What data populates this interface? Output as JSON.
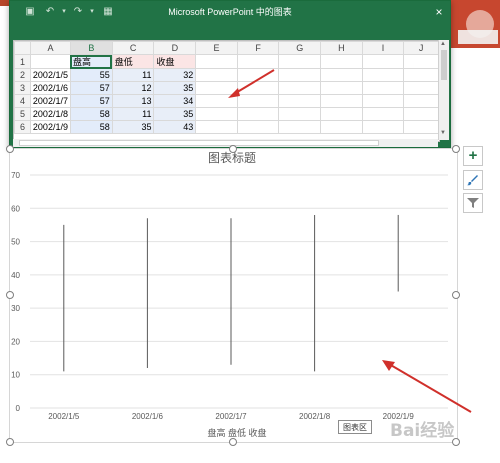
{
  "window": {
    "title": "Microsoft PowerPoint 中的图表",
    "close_icon": "×"
  },
  "sheet": {
    "columns": [
      "A",
      "B",
      "C",
      "D",
      "E",
      "F",
      "G",
      "H",
      "I",
      "J"
    ],
    "row_numbers": [
      "1",
      "2",
      "3",
      "4",
      "5",
      "6"
    ],
    "header_row": [
      "",
      "盘高",
      "盘低",
      "收盘"
    ],
    "rows": [
      [
        "2002/1/5",
        "55",
        "11",
        "32"
      ],
      [
        "2002/1/6",
        "57",
        "12",
        "35"
      ],
      [
        "2002/1/7",
        "57",
        "13",
        "34"
      ],
      [
        "2002/1/8",
        "58",
        "11",
        "35"
      ],
      [
        "2002/1/9",
        "58",
        "35",
        "43"
      ]
    ]
  },
  "chart_data": {
    "type": "stock",
    "title": "图表标题",
    "categories": [
      "2002/1/5",
      "2002/1/6",
      "2002/1/7",
      "2002/1/8",
      "2002/1/9"
    ],
    "series": [
      {
        "name": "盘高",
        "values": [
          55,
          57,
          57,
          58,
          58
        ]
      },
      {
        "name": "盘低",
        "values": [
          11,
          12,
          13,
          11,
          35
        ]
      },
      {
        "name": "收盘",
        "values": [
          32,
          35,
          34,
          35,
          43
        ]
      }
    ],
    "ylim": [
      0,
      70
    ],
    "yticks": [
      0,
      10,
      20,
      30,
      40,
      50,
      60,
      70
    ],
    "grid": true,
    "legend": "bottom",
    "legend_text": "盘高    盘低    收盘"
  },
  "tooltip": "图表区",
  "side_buttons": {
    "add": "+",
    "style": "brush-icon",
    "filter": "filter-icon"
  },
  "colors": {
    "accent": "#217346",
    "arrow": "#d0302b",
    "hilo": "#595959"
  },
  "watermark": "Bai经验"
}
